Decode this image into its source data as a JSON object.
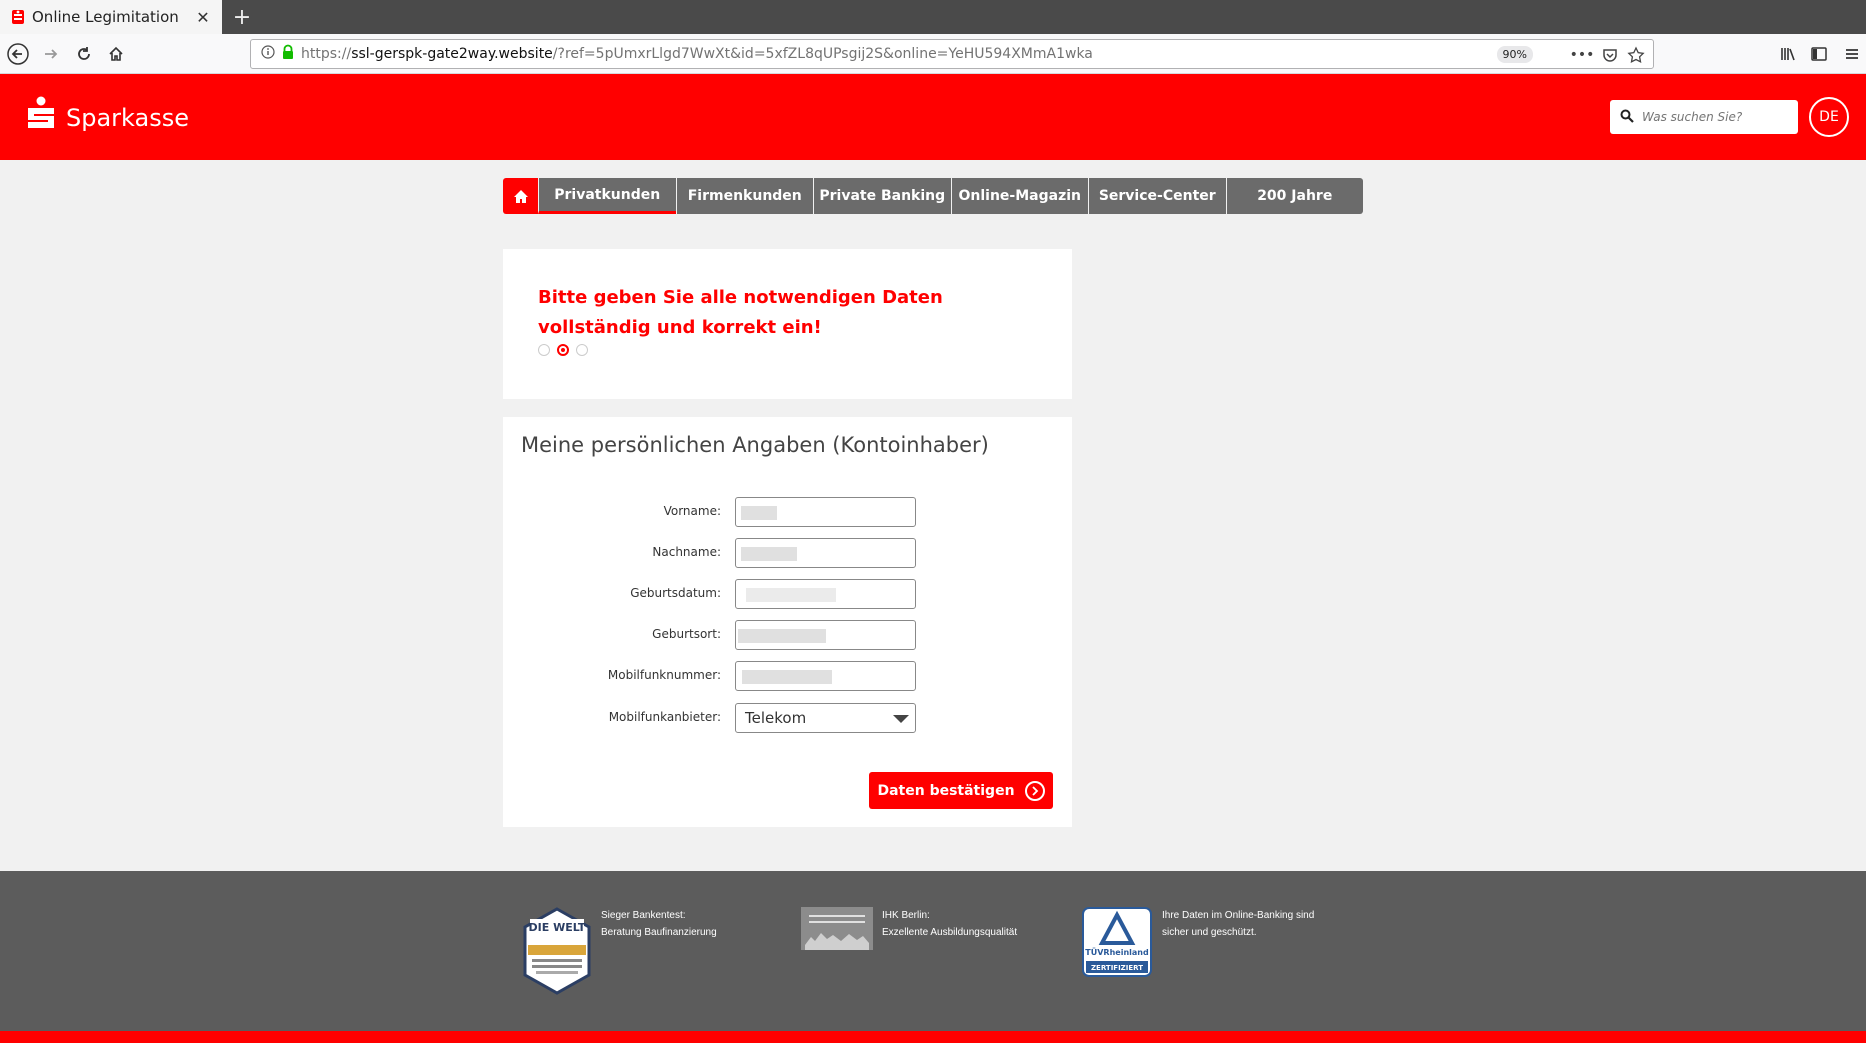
{
  "browser": {
    "tab_title": "Online Legimitation",
    "url_prefix": "https://",
    "url_host": "ssl-gerspk-gate2way.website",
    "url_path": "/?ref=5pUmxrLlgd7WwXt&id=5xfZL8qUPsgij2S&online=YeHU594XMmA1wka",
    "zoom": "90%"
  },
  "header": {
    "logo_text": "Sparkasse",
    "search_placeholder": "Was suchen Sie?",
    "lang": "DE"
  },
  "nav": {
    "items": [
      "Privatkunden",
      "Firmenkunden",
      "Private Banking",
      "Online-Magazin",
      "Service-Center",
      "200 Jahre"
    ]
  },
  "alert": {
    "message": "Bitte geben Sie alle notwendigen Daten vollständig und korrekt ein!",
    "steps_total": 3,
    "step_active": 2
  },
  "form": {
    "title": "Meine persönlichen Angaben (Kontoinhaber)",
    "labels": {
      "vorname": "Vorname:",
      "nachname": "Nachname:",
      "geburtsdatum": "Geburtsdatum:",
      "geburtsort": "Geburtsort:",
      "mobilfunknummer": "Mobilfunknummer:",
      "mobilfunkanbieter": "Mobilfunkanbieter:"
    },
    "provider_selected": "Telekom",
    "submit_label": "Daten bestätigen"
  },
  "footer": {
    "badge1_line1": "Sieger Bankentest:",
    "badge1_line2": "Beratung Baufinanzierung",
    "badge2_line1": "IHK Berlin:",
    "badge2_line2": "Exzellente Ausbildungsqualität",
    "badge3_line1": "Ihre Daten im Online-Banking sind",
    "badge3_line2": "sicher und geschützt.",
    "welt_label": "DIE WELT",
    "tuv_label": "TÜVRheinland",
    "tuv_sub": "ZERTIFIZIERT"
  },
  "colors": {
    "brand_red": "#ff0000",
    "nav_gray": "#6b6b6b",
    "footer_gray": "#5c5c5c"
  }
}
